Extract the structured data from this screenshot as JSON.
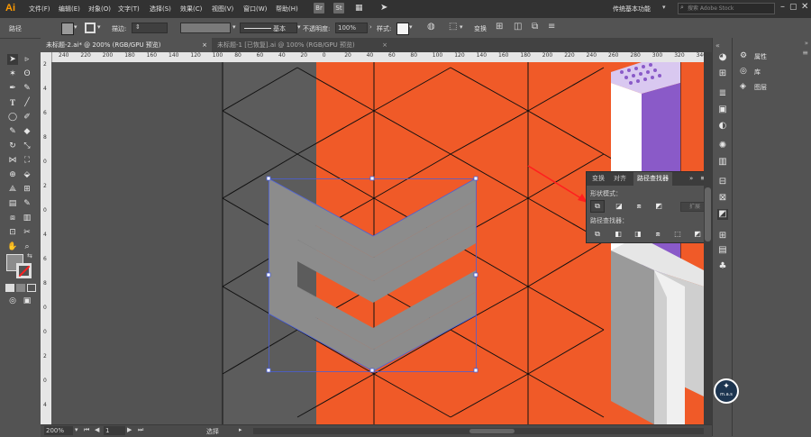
{
  "app": {
    "logo": "Ai"
  },
  "menu": [
    "文件(F)",
    "编辑(E)",
    "对象(O)",
    "文字(T)",
    "选择(S)",
    "效果(C)",
    "视图(V)",
    "窗口(W)",
    "帮助(H)"
  ],
  "menu_buttons": [
    "Br",
    "St"
  ],
  "workspace": "传统基本功能",
  "search": {
    "placeholder": "搜索 Adobe Stock"
  },
  "controlbar": {
    "path_label": "路径",
    "stroke_label": "描边:",
    "basic_label": "基本",
    "opacity_label": "不透明度:",
    "opacity_value": "100%",
    "style_label": "样式:",
    "transform_label": "变换"
  },
  "tabs": [
    {
      "label": "未标题-2.ai* @ 200% (RGB/GPU 预览)",
      "active": true
    },
    {
      "label": "未标题-1 [已恢复].ai @ 100% (RGB/GPU 预览)",
      "active": false
    }
  ],
  "ruler_top": [
    "240",
    "220",
    "200",
    "180",
    "160",
    "140",
    "120",
    "100",
    "80",
    "60",
    "40",
    "20",
    "0",
    "20",
    "40",
    "60",
    "80",
    "100",
    "120",
    "140",
    "160",
    "180",
    "200",
    "220",
    "240",
    "260",
    "280",
    "300",
    "320",
    "340"
  ],
  "ruler_left": [
    "2",
    "4",
    "6",
    "8",
    "0",
    "2",
    "0",
    "4",
    "6",
    "8",
    "0",
    "0",
    "2",
    "0",
    "4"
  ],
  "pathfinder": {
    "tabs": [
      "变换",
      "对齐",
      "路径查找器"
    ],
    "active_tab": "路径查找器",
    "shape_modes_label": "形状模式：",
    "expand_label": "扩展",
    "pathfinders_label": "路径查找器："
  },
  "right_panel": {
    "items": [
      "属性",
      "库",
      "图层"
    ]
  },
  "status": {
    "zoom": "200%",
    "page": "1",
    "tool": "选择"
  },
  "colors": {
    "accent_orange": "#f05a28",
    "purple": "#8a5ac8",
    "shape_gray": "#8c8c8c",
    "selection": "#4a5fd8",
    "arrow": "#ff1e1e"
  },
  "badge": {
    "text": "m.a.s"
  }
}
